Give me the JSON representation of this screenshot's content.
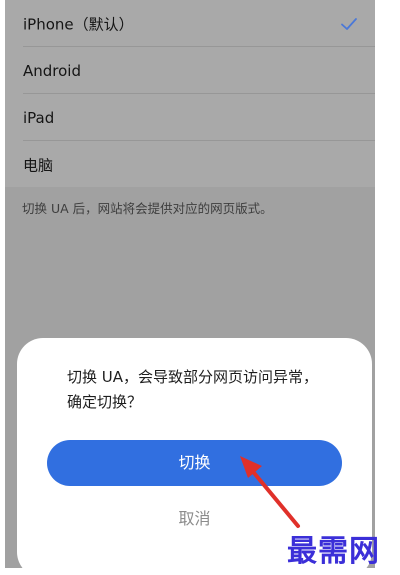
{
  "ua_options": [
    {
      "label": "iPhone（默认）",
      "selected": true
    },
    {
      "label": "Android",
      "selected": false
    },
    {
      "label": "iPad",
      "selected": false
    },
    {
      "label": "电脑",
      "selected": false
    }
  ],
  "hint": "切换 UA 后，网站将会提供对应的网页版式。",
  "dialog": {
    "message": "切换 UA，会导致部分网页访问异常，确定切换？",
    "confirm_label": "切换",
    "cancel_label": "取消"
  },
  "colors": {
    "accent": "#316fe0",
    "check": "#4a78d8",
    "arrow": "#e0302a",
    "watermark": "#3b2fd8"
  },
  "watermark": "最需网"
}
